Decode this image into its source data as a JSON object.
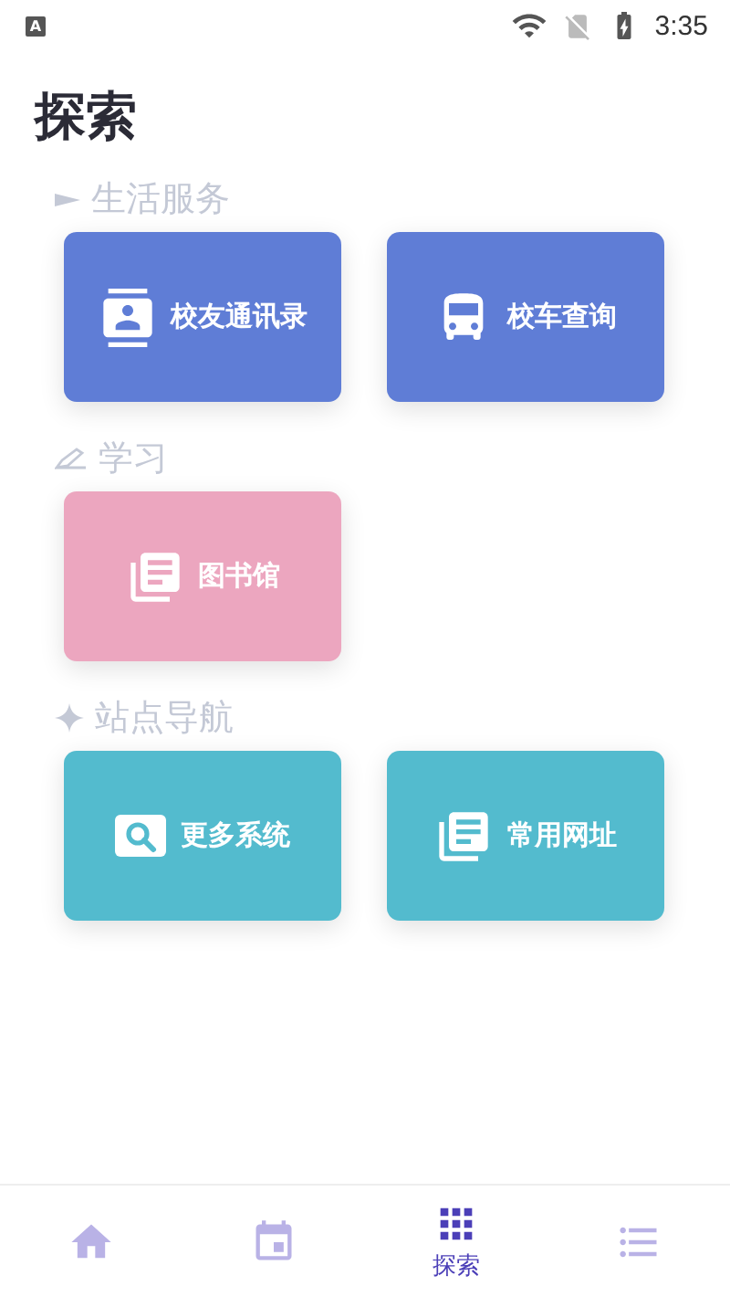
{
  "status_bar": {
    "notification": "A",
    "time": "3:35"
  },
  "title": "探索",
  "sections": [
    {
      "header": "生活服务",
      "tiles": [
        {
          "label": "校友通讯录",
          "color": "#5f7dd6"
        },
        {
          "label": "校车查询",
          "color": "#5f7dd6"
        }
      ]
    },
    {
      "header": "学习",
      "tiles": [
        {
          "label": "图书馆",
          "color": "#eca6bf"
        }
      ]
    },
    {
      "header": "站点导航",
      "tiles": [
        {
          "label": "更多系统",
          "color": "#53bbce"
        },
        {
          "label": "常用网址",
          "color": "#53bbce"
        }
      ]
    }
  ],
  "nav": [
    {
      "selected": false
    },
    {
      "selected": false
    },
    {
      "selected": true,
      "label": "探索"
    },
    {
      "selected": false
    }
  ]
}
